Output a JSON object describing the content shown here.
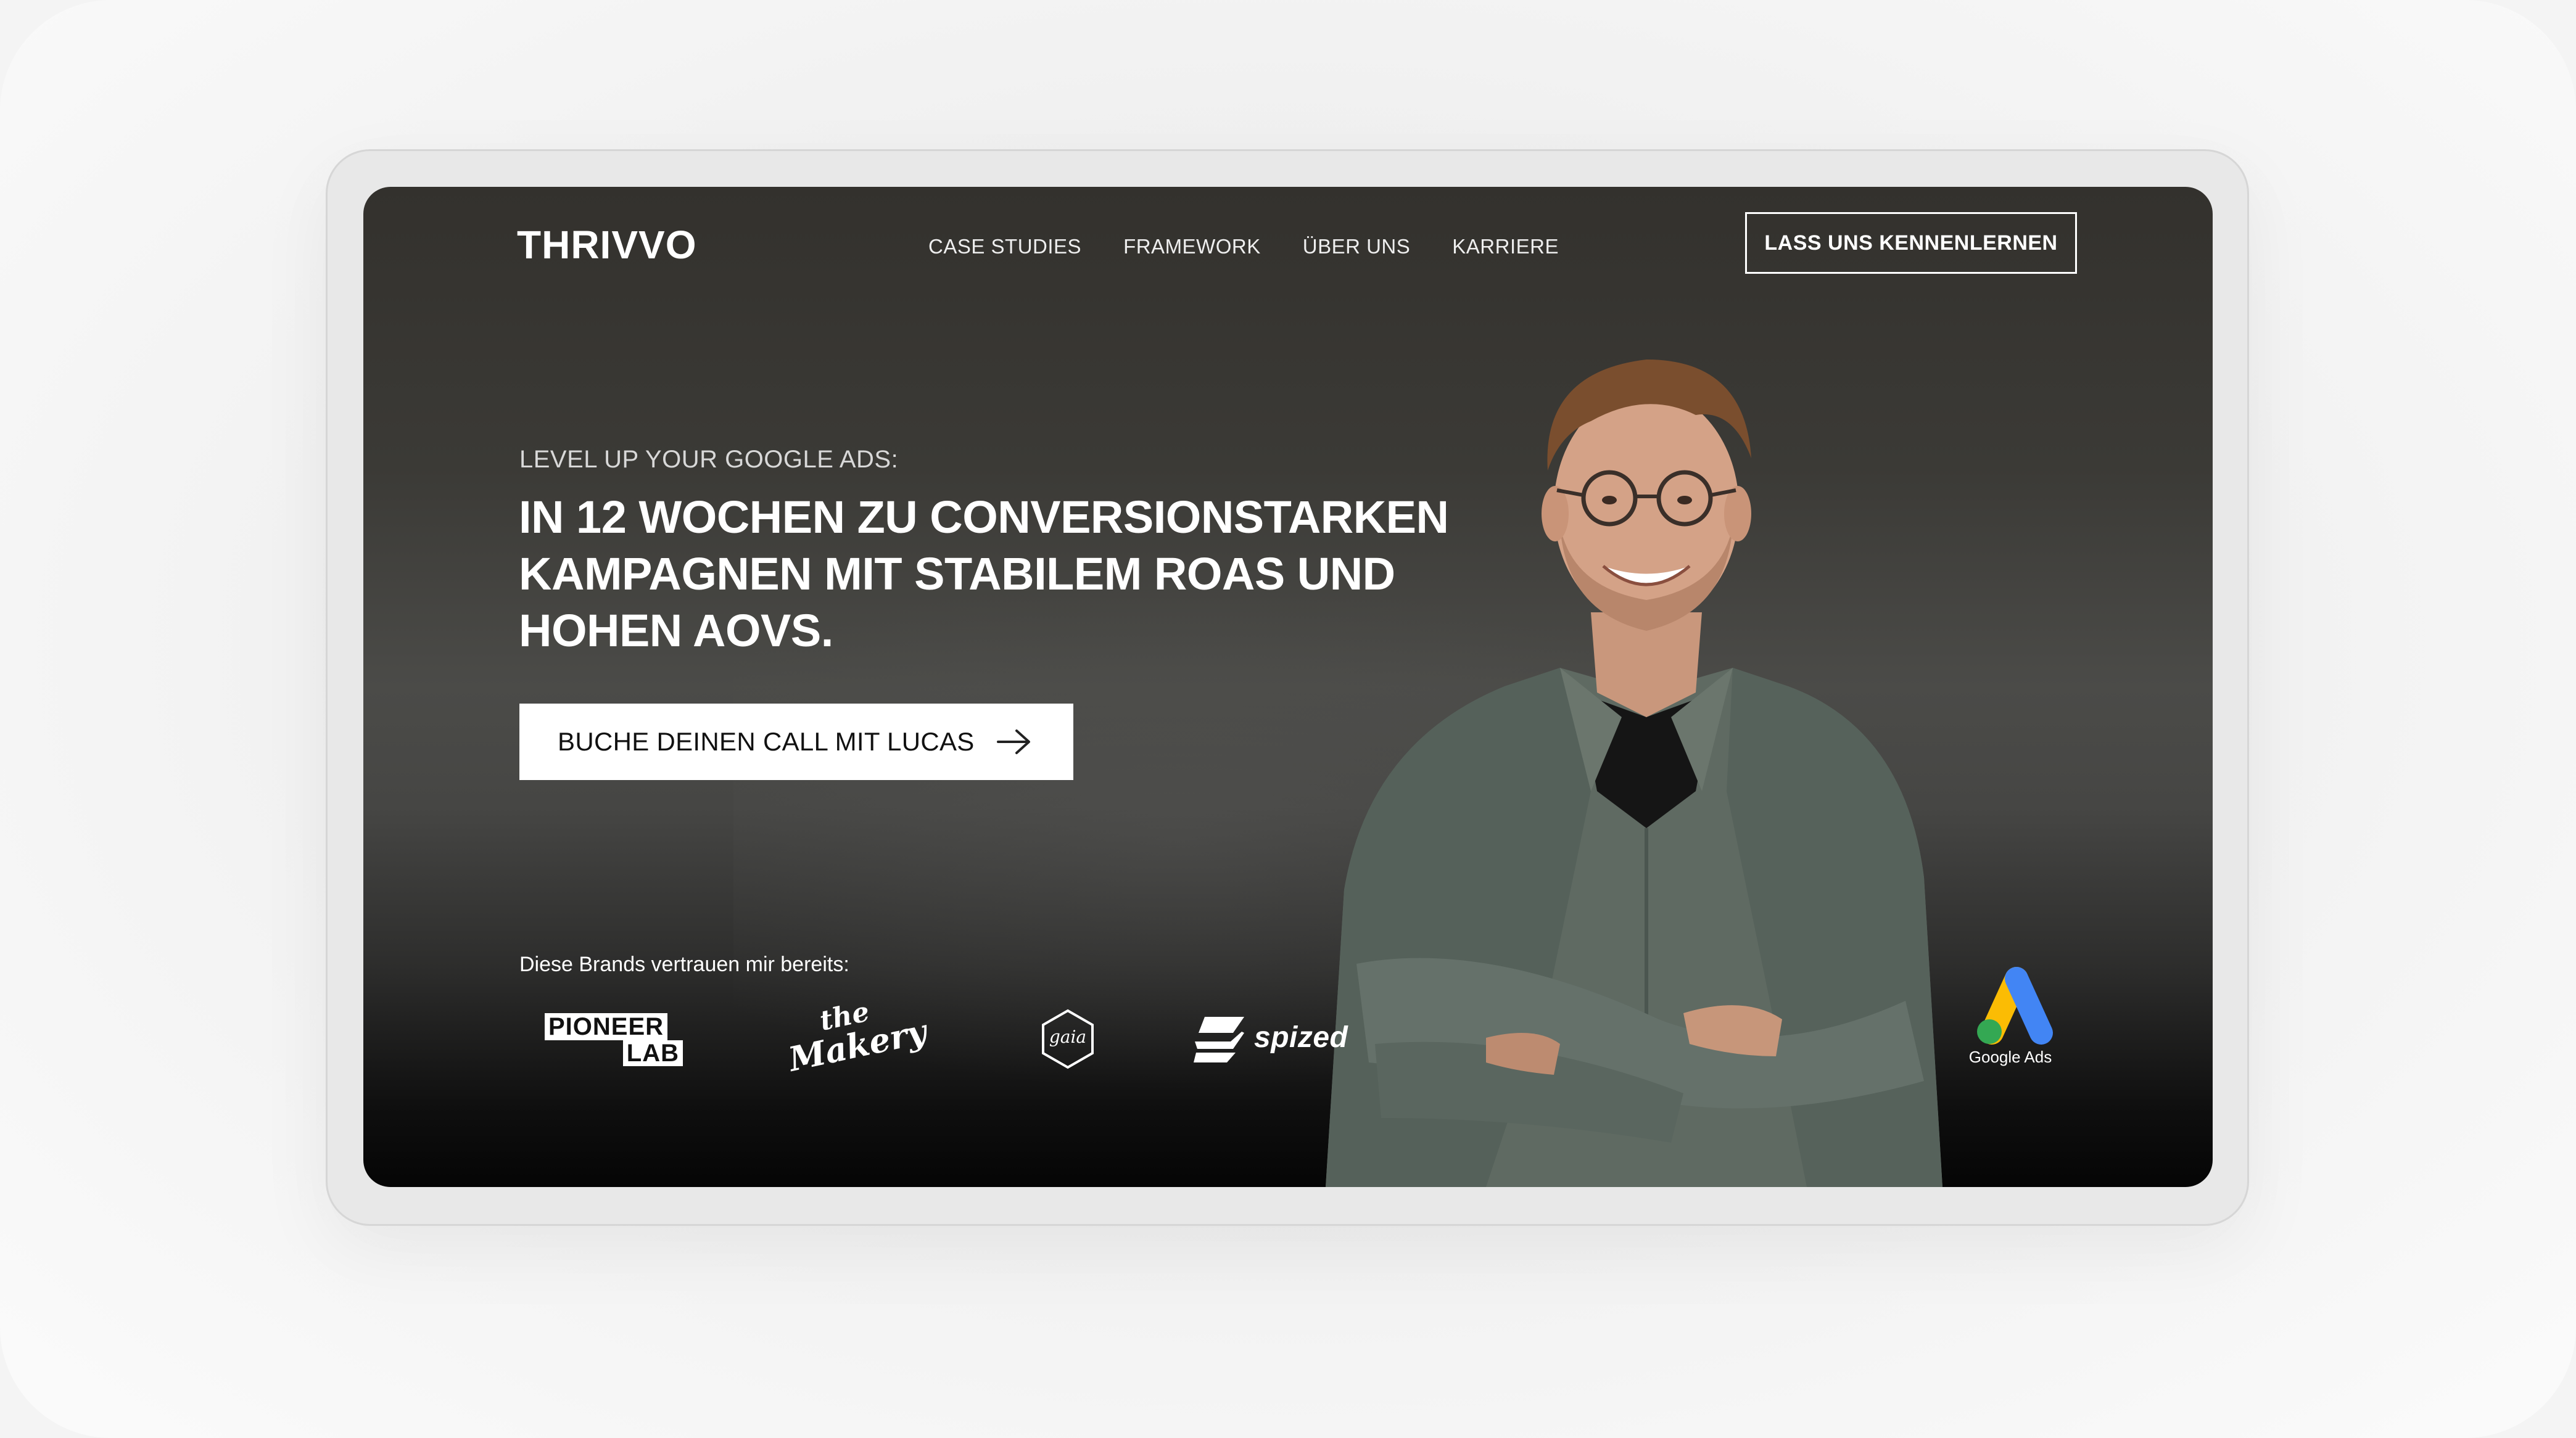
{
  "nav": {
    "logo": "THRIVVO",
    "items": [
      {
        "label": "CASE STUDIES"
      },
      {
        "label": "FRAMEWORK"
      },
      {
        "label": "ÜBER UNS"
      },
      {
        "label": "KARRIERE"
      }
    ],
    "cta_label": "LASS UNS KENNENLERNEN"
  },
  "hero": {
    "eyebrow": "LEVEL UP YOUR GOOGLE ADS:",
    "headline_lines": [
      "IN 12 WOCHEN ZU CONVERSIONSTARKEN",
      "KAMPAGNEN MIT STABILEM ROAS UND",
      "HOHEN AOVS."
    ],
    "cta_label": "BUCHE DEINEN CALL MIT LUCAS",
    "cta_icon": "arrow-right-icon"
  },
  "brands": {
    "label": "Diese Brands vertrauen mir bereits:",
    "logos": {
      "pioneer_line1": "PIONEER",
      "pioneer_line2": "LAB",
      "makery_the": "the",
      "makery_name": "Makery",
      "gaia": "gaia",
      "spized": "spized"
    }
  },
  "badge": {
    "label": "Google Ads",
    "colors": {
      "blue": "#4285F4",
      "yellow": "#FBBC04",
      "green": "#34A853"
    }
  },
  "theme": {
    "background_dark": "#3b3a36",
    "cta_bg": "#ffffff",
    "text": "#ffffff"
  }
}
